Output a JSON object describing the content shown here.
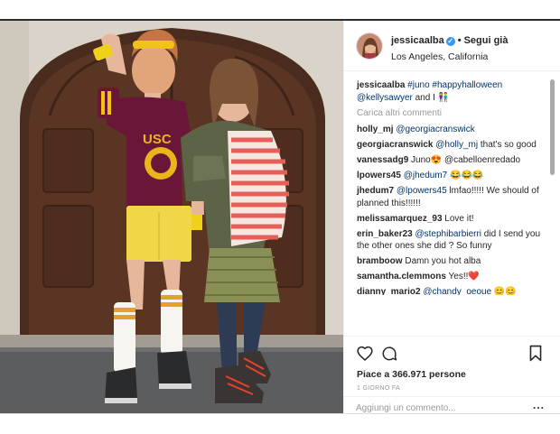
{
  "post": {
    "username": "jessicaalba",
    "follow_status": "Segui già",
    "location": "Los Angeles, California",
    "verified_icon": "verified-badge-icon",
    "likes": "Piace a 366.971 persone",
    "timestamp": "1 GIORNO FA",
    "comment_placeholder": "Aggiungi un commento...",
    "more_options": "...",
    "colors": {
      "link": "#003569",
      "verified": "#3897f0",
      "muted": "#999999",
      "heart_emoji": "#e0245e"
    }
  },
  "caption": {
    "user": "jessicaalba",
    "tags": "#juno #happyhalloween",
    "mention": "@kellysawyer",
    "rest": " and I"
  },
  "load_more": "Carica altri commenti",
  "comments": [
    {
      "user": "holly_mj",
      "mention": "@georgiacranswick",
      "text": ""
    },
    {
      "user": "georgiacranswick",
      "mention": "@holly_mj",
      "text": " that's so good"
    },
    {
      "user": "vanessadg9",
      "mention": "",
      "text": "Juno😍 @cabelloenredado"
    },
    {
      "user": "lpowers45",
      "mention": "@jhedum7",
      "text": " 😂😂😂"
    },
    {
      "user": "jhedum7",
      "mention": "@lpowers45",
      "text": " lmfao!!!!! We should of planned this!!!!!!"
    },
    {
      "user": "melissamarquez_93",
      "mention": "",
      "text": "Love it!"
    },
    {
      "user": "erin_baker23",
      "mention": "@stephibarbierri",
      "text": " did I send you the other ones she did ? So funny"
    },
    {
      "user": "bramboow",
      "mention": "",
      "text": "Damn you hot alba"
    },
    {
      "user": "samantha.clemmons",
      "mention": "",
      "text": "Yes!!❤️"
    }
  ],
  "cut_comment": {
    "user": "dianny_mario2",
    "text": " @chandy_oeoue 😊😊"
  },
  "icons": {
    "like": "heart-icon",
    "comment": "comment-bubble-icon",
    "save": "bookmark-icon"
  }
}
